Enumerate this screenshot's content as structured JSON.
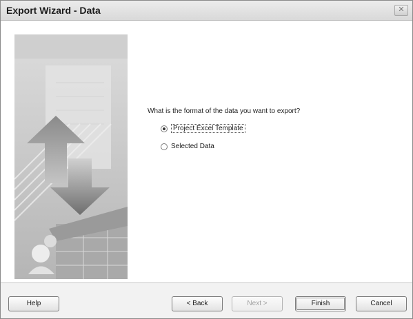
{
  "window": {
    "title": "Export Wizard - Data",
    "close_glyph": "✕"
  },
  "main": {
    "question": "What is the format of the data you want to export?",
    "options": [
      {
        "label": "Project Excel Template",
        "selected": true
      },
      {
        "label": "Selected Data",
        "selected": false
      }
    ]
  },
  "footer": {
    "help": "Help",
    "back": "< Back",
    "next": "Next >",
    "finish": "Finish",
    "cancel": "Cancel"
  },
  "side_art": {
    "icon": "export-wizard-illustration",
    "colors": [
      "#e2e2e2",
      "#bdbdbd",
      "#8f8f8f"
    ]
  }
}
